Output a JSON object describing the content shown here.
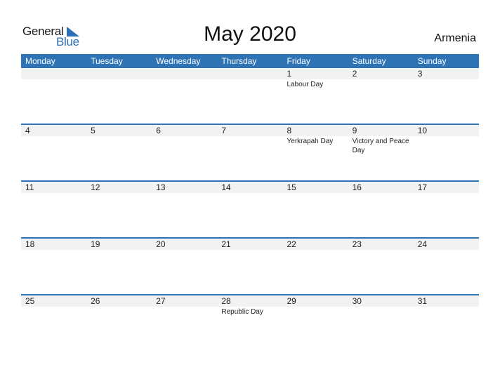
{
  "logo": {
    "general": "General",
    "blue": "Blue",
    "accent": "#2a6fb5"
  },
  "title": "May 2020",
  "country": "Armenia",
  "colors": {
    "header_bg": "#2e74b5",
    "date_strip": "#f2f2f2"
  },
  "weekdays": [
    "Monday",
    "Tuesday",
    "Wednesday",
    "Thursday",
    "Friday",
    "Saturday",
    "Sunday"
  ],
  "weeks": [
    [
      {
        "day": "",
        "holiday": ""
      },
      {
        "day": "",
        "holiday": ""
      },
      {
        "day": "",
        "holiday": ""
      },
      {
        "day": "",
        "holiday": ""
      },
      {
        "day": "1",
        "holiday": "Labour Day"
      },
      {
        "day": "2",
        "holiday": ""
      },
      {
        "day": "3",
        "holiday": ""
      }
    ],
    [
      {
        "day": "4",
        "holiday": ""
      },
      {
        "day": "5",
        "holiday": ""
      },
      {
        "day": "6",
        "holiday": ""
      },
      {
        "day": "7",
        "holiday": ""
      },
      {
        "day": "8",
        "holiday": "Yerkrapah Day"
      },
      {
        "day": "9",
        "holiday": "Victory and Peace Day"
      },
      {
        "day": "10",
        "holiday": ""
      }
    ],
    [
      {
        "day": "11",
        "holiday": ""
      },
      {
        "day": "12",
        "holiday": ""
      },
      {
        "day": "13",
        "holiday": ""
      },
      {
        "day": "14",
        "holiday": ""
      },
      {
        "day": "15",
        "holiday": ""
      },
      {
        "day": "16",
        "holiday": ""
      },
      {
        "day": "17",
        "holiday": ""
      }
    ],
    [
      {
        "day": "18",
        "holiday": ""
      },
      {
        "day": "19",
        "holiday": ""
      },
      {
        "day": "20",
        "holiday": ""
      },
      {
        "day": "21",
        "holiday": ""
      },
      {
        "day": "22",
        "holiday": ""
      },
      {
        "day": "23",
        "holiday": ""
      },
      {
        "day": "24",
        "holiday": ""
      }
    ],
    [
      {
        "day": "25",
        "holiday": ""
      },
      {
        "day": "26",
        "holiday": ""
      },
      {
        "day": "27",
        "holiday": ""
      },
      {
        "day": "28",
        "holiday": "Republic Day"
      },
      {
        "day": "29",
        "holiday": ""
      },
      {
        "day": "30",
        "holiday": ""
      },
      {
        "day": "31",
        "holiday": ""
      }
    ]
  ]
}
